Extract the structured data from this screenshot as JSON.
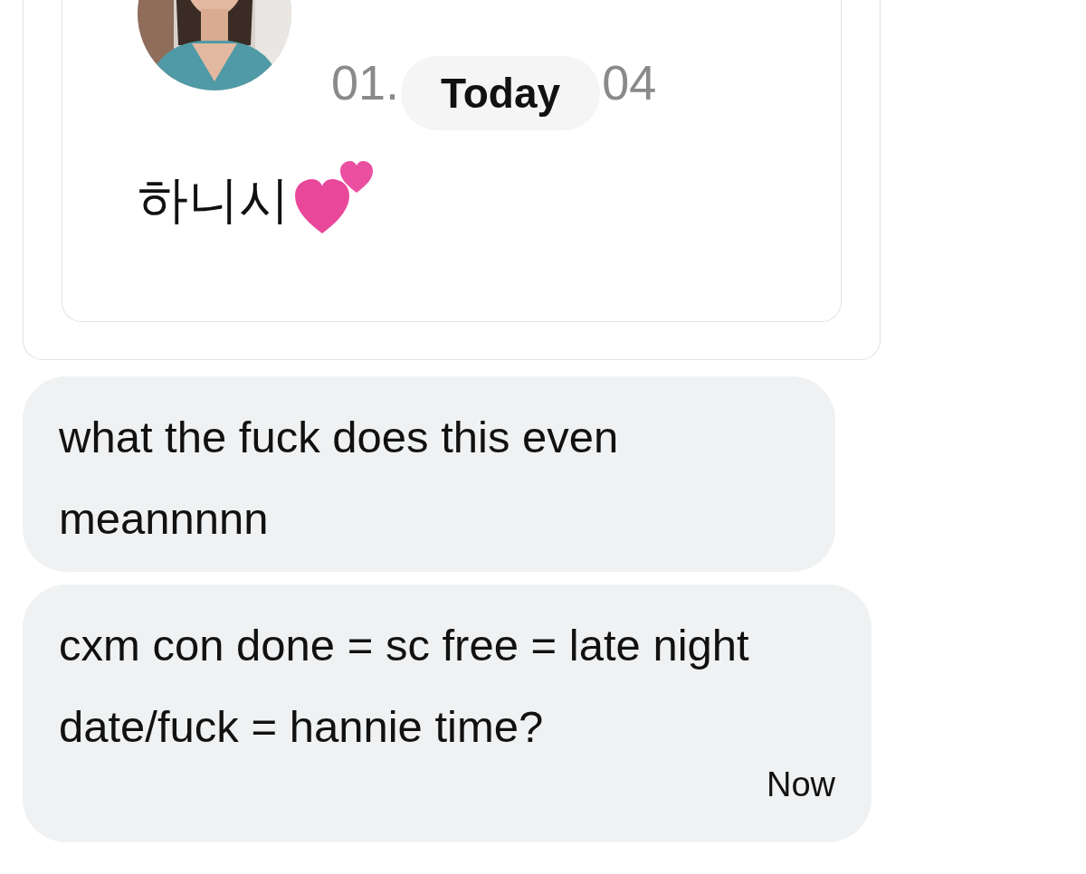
{
  "shared_post": {
    "timestamp_parts": [
      "01.",
      "04"
    ],
    "text": "하니시",
    "date_divider": "Today"
  },
  "messages": [
    {
      "text": "what the fuck does this even meannnnn"
    },
    {
      "text": "cxm con done = sc free = late night date/fuck = hannie time?",
      "time": "Now"
    }
  ]
}
